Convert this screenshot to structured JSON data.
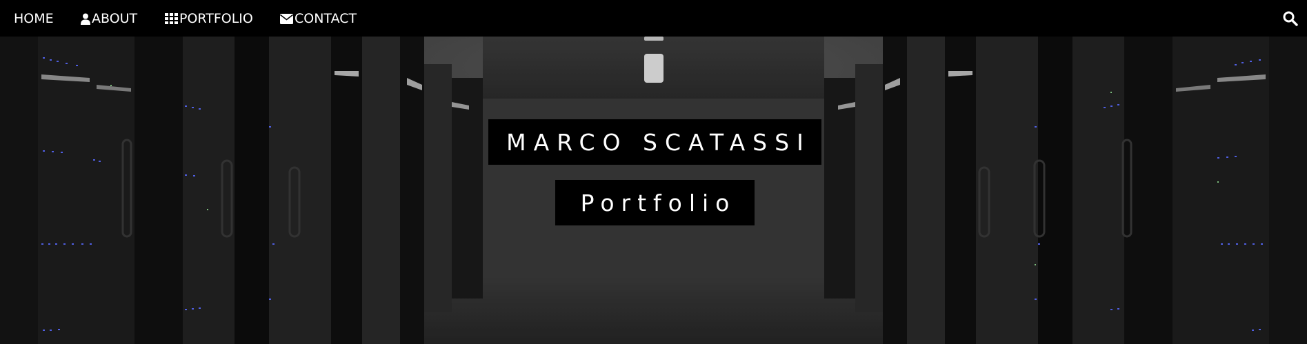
{
  "nav": {
    "home": "HOME",
    "about": "ABOUT",
    "portfolio": "PORTFOLIO",
    "contact": "CONTACT",
    "icons": {
      "about": "user-icon",
      "portfolio": "grid-icon",
      "contact": "envelope-icon",
      "search": "search-icon"
    }
  },
  "hero": {
    "title": "MARCO SCATASSI",
    "subtitle": "Portfolio",
    "background": "server-room-photo"
  },
  "colors": {
    "navbar": "#000000",
    "text": "#ffffff",
    "label_bg": "#000000"
  }
}
